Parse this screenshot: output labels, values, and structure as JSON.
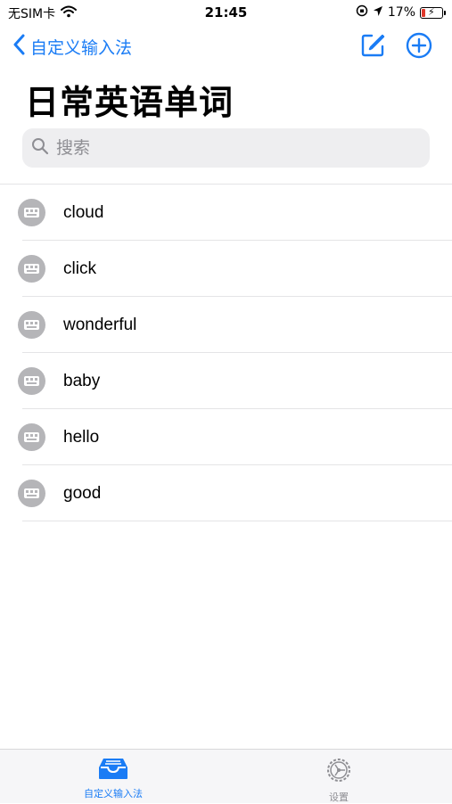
{
  "status_bar": {
    "carrier": "无SIM卡",
    "time": "21:45",
    "battery_percent": "17%",
    "battery_level": 0.17
  },
  "nav": {
    "back_label": "自定义输入法",
    "edit_icon": "compose-icon",
    "add_icon": "plus-circle-icon"
  },
  "page_title": "日常英语单词",
  "search": {
    "placeholder": "搜索"
  },
  "items": [
    {
      "label": "cloud"
    },
    {
      "label": "click"
    },
    {
      "label": "wonderful"
    },
    {
      "label": "baby"
    },
    {
      "label": "hello"
    },
    {
      "label": "good"
    }
  ],
  "tabs": [
    {
      "label": "自定义输入法",
      "icon": "tray-icon",
      "active": true
    },
    {
      "label": "设置",
      "icon": "gear-icon",
      "active": false
    }
  ],
  "colors": {
    "accent": "#1a7cf5",
    "icon_gray": "#b5b5b8",
    "tab_inactive": "#8e8e93"
  }
}
